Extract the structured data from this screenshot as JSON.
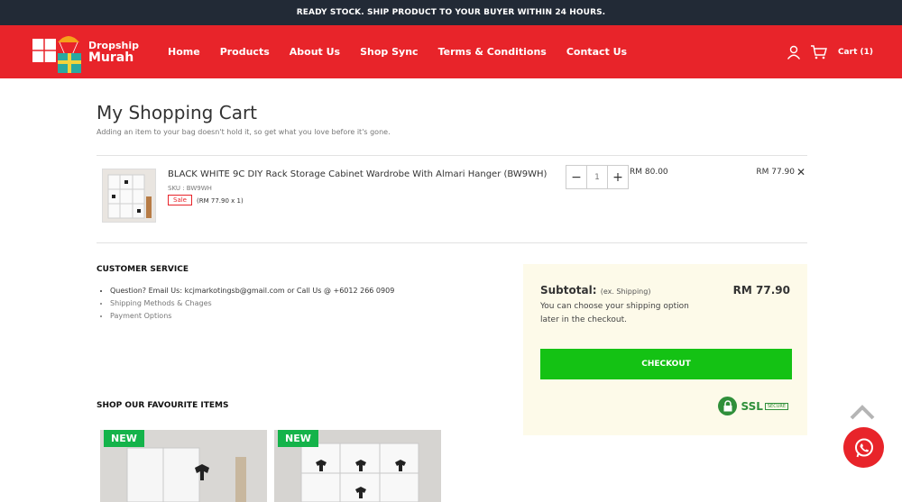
{
  "topbar": {
    "message": "READY STOCK. SHIP PRODUCT TO YOUR BUYER WITHIN 24 HOURS."
  },
  "logo": {
    "line1": "Dropship",
    "line2": "Murah"
  },
  "nav": {
    "items": [
      "Home",
      "Products",
      "About Us",
      "Shop Sync",
      "Terms & Conditions",
      "Contact Us"
    ]
  },
  "header_right": {
    "user_icon": "user-icon",
    "cart_icon": "cart-icon",
    "cart_label": "Cart (1)"
  },
  "page": {
    "title": "My Shopping Cart",
    "subtitle": "Adding an item to your bag doesn't hold it, so get what you love before it's gone."
  },
  "cart": {
    "items": [
      {
        "name": "BLACK WHITE 9C DIY Rack Storage Cabinet Wardrobe With Almari Hanger (BW9WH)",
        "sku": "SKU : BW9WH",
        "badge": "Sale",
        "unit_price": "(RM 77.90 x 1)",
        "quantity": "1",
        "original_price": "RM 80.00",
        "line_total": "RM 77.90"
      }
    ]
  },
  "customer_service": {
    "title": "CUSTOMER SERVICE",
    "items": [
      "Question? Email Us: kcjmarkotingsb@gmail.com or Call Us @ +6012 266 0909",
      "Shipping Methods & Chages",
      "Payment Options"
    ]
  },
  "favourites": {
    "title": "SHOP OUR FAVOURITE ITEMS",
    "cards": [
      {
        "badge": "NEW"
      },
      {
        "badge": "NEW"
      }
    ]
  },
  "summary": {
    "label": "Subtotal:",
    "label_note": "(ex. Shipping)",
    "value": "RM 77.90",
    "note": "You can choose your shipping option later in the checkout.",
    "checkout_label": "CHECKOUT",
    "ssl_text": "SSL",
    "ssl_secure": "SECURE"
  },
  "colors": {
    "brand_red": "#e8242a",
    "checkout_green": "#14c214",
    "topbar": "#222a36",
    "summary_bg": "#fdfae9"
  }
}
